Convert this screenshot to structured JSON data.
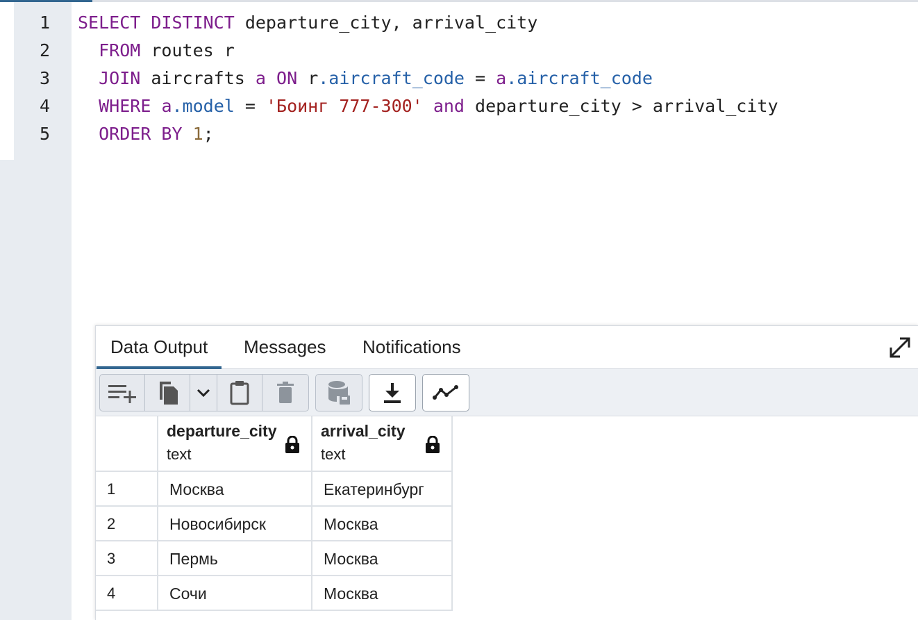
{
  "editor": {
    "lines": [
      {
        "n": "1",
        "tokens": [
          [
            "kw",
            "SELECT DISTINCT"
          ],
          [
            "t",
            " departure_city, arrival_city"
          ]
        ]
      },
      {
        "n": "2",
        "tokens": [
          [
            "t",
            "  "
          ],
          [
            "kw",
            "FROM"
          ],
          [
            "t",
            " routes r"
          ]
        ]
      },
      {
        "n": "3",
        "tokens": [
          [
            "t",
            "  "
          ],
          [
            "kw",
            "JOIN"
          ],
          [
            "t",
            " aircrafts "
          ],
          [
            "kw",
            "a"
          ],
          [
            "t",
            " "
          ],
          [
            "kw",
            "ON"
          ],
          [
            "t",
            " r"
          ],
          [
            "prop",
            ".aircraft_code"
          ],
          [
            "t",
            " = "
          ],
          [
            "kw",
            "a"
          ],
          [
            "prop",
            ".aircraft_code"
          ]
        ]
      },
      {
        "n": "4",
        "tokens": [
          [
            "t",
            "  "
          ],
          [
            "kw",
            "WHERE"
          ],
          [
            "t",
            " "
          ],
          [
            "kw",
            "a"
          ],
          [
            "prop",
            ".model"
          ],
          [
            "t",
            " = "
          ],
          [
            "str",
            "'Боинг 777-300'"
          ],
          [
            "t",
            " "
          ],
          [
            "kw",
            "and"
          ],
          [
            "t",
            " departure_city > arrival_city"
          ]
        ]
      },
      {
        "n": "5",
        "tokens": [
          [
            "t",
            "  "
          ],
          [
            "kw",
            "ORDER BY"
          ],
          [
            "t",
            " "
          ],
          [
            "num",
            "1"
          ],
          [
            "t",
            ";"
          ]
        ]
      }
    ]
  },
  "results": {
    "tabs": {
      "data_output": "Data Output",
      "messages": "Messages",
      "notifications": "Notifications"
    },
    "toolbar_icons": [
      "add-row-icon",
      "copy-icon",
      "chevron-down-icon",
      "paste-icon",
      "delete-icon",
      "save-data-icon",
      "download-icon",
      "graph-icon"
    ],
    "columns": [
      {
        "name": "departure_city",
        "type": "text"
      },
      {
        "name": "arrival_city",
        "type": "text"
      }
    ],
    "rows": [
      {
        "n": "1",
        "departure_city": "Москва",
        "arrival_city": "Екатеринбург"
      },
      {
        "n": "2",
        "departure_city": "Новосибирск",
        "arrival_city": "Москва"
      },
      {
        "n": "3",
        "departure_city": "Пермь",
        "arrival_city": "Москва"
      },
      {
        "n": "4",
        "departure_city": "Сочи",
        "arrival_city": "Москва"
      }
    ]
  },
  "colors": {
    "keyword": "#7d1e8c",
    "property": "#2661a8",
    "string": "#a3211f",
    "number": "#8a6a3a",
    "accent": "#326690"
  }
}
